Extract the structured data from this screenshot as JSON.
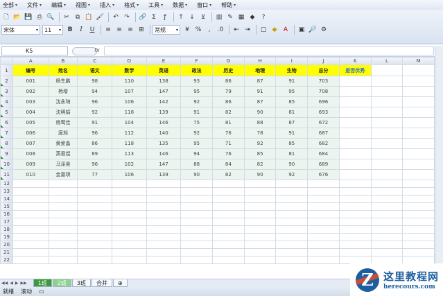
{
  "menu": [
    {
      "label": "全部"
    },
    {
      "label": "文件"
    },
    {
      "label": "编辑"
    },
    {
      "label": "视图"
    },
    {
      "label": "插入"
    },
    {
      "label": "格式"
    },
    {
      "label": "工具"
    },
    {
      "label": "数据"
    },
    {
      "label": "窗口"
    },
    {
      "label": "帮助"
    }
  ],
  "toolbar": {
    "font_name": "宋体",
    "font_size": "11",
    "number_format": "常规"
  },
  "formula_bar": {
    "name_box": "K5",
    "fx_label": "fx",
    "formula": ""
  },
  "columns": [
    "A",
    "B",
    "C",
    "D",
    "E",
    "F",
    "G",
    "H",
    "I",
    "J",
    "K",
    "L",
    "M"
  ],
  "table": {
    "headers": [
      "编号",
      "姓名",
      "语文",
      "数学",
      "英语",
      "政法",
      "历史",
      "地理",
      "生物",
      "总分",
      "是否优秀"
    ],
    "rows": [
      [
        "001",
        "杨生鹏",
        "98",
        "110",
        "138",
        "93",
        "86",
        "87",
        "91",
        "703",
        ""
      ],
      [
        "002",
        "杨增",
        "94",
        "107",
        "147",
        "95",
        "79",
        "91",
        "95",
        "708",
        ""
      ],
      [
        "003",
        "沈永琦",
        "96",
        "106",
        "142",
        "92",
        "86",
        "87",
        "85",
        "696",
        ""
      ],
      [
        "004",
        "沈明娟",
        "92",
        "118",
        "139",
        "91",
        "82",
        "90",
        "81",
        "693",
        ""
      ],
      [
        "005",
        "杨鹜佳",
        "91",
        "104",
        "146",
        "75",
        "81",
        "88",
        "87",
        "672",
        ""
      ],
      [
        "006",
        "唐旭",
        "96",
        "112",
        "140",
        "92",
        "76",
        "78",
        "91",
        "687",
        ""
      ],
      [
        "007",
        "黄爱晶",
        "86",
        "118",
        "135",
        "95",
        "71",
        "92",
        "85",
        "682",
        ""
      ],
      [
        "008",
        "燕君煜",
        "89",
        "113",
        "146",
        "94",
        "76",
        "85",
        "81",
        "684",
        ""
      ],
      [
        "009",
        "马泽昊",
        "96",
        "102",
        "147",
        "88",
        "84",
        "82",
        "90",
        "689",
        ""
      ],
      [
        "010",
        "金嘉琪",
        "77",
        "106",
        "139",
        "90",
        "82",
        "90",
        "92",
        "676",
        ""
      ]
    ]
  },
  "row_numbers": [
    "1",
    "2",
    "3",
    "4",
    "5",
    "6",
    "7",
    "8",
    "9",
    "10",
    "11",
    "12",
    "13",
    "14",
    "15",
    "16",
    "17",
    "18",
    "19",
    "20",
    "21",
    "22"
  ],
  "sheet_tabs": [
    {
      "label": "1班"
    },
    {
      "label": "2班"
    },
    {
      "label": "3班"
    },
    {
      "label": "合并"
    }
  ],
  "status": {
    "ready": "就绪",
    "scroll": "滚动"
  },
  "watermark": {
    "logo_letter": "Z",
    "name": "这里教程网",
    "url": "herecours.com"
  },
  "colors": {
    "header_fill": "#ffff00",
    "band_fill": "#ecf4ef",
    "active_tab": "#3c9a3c",
    "accent_text": "#2d6ccd"
  }
}
